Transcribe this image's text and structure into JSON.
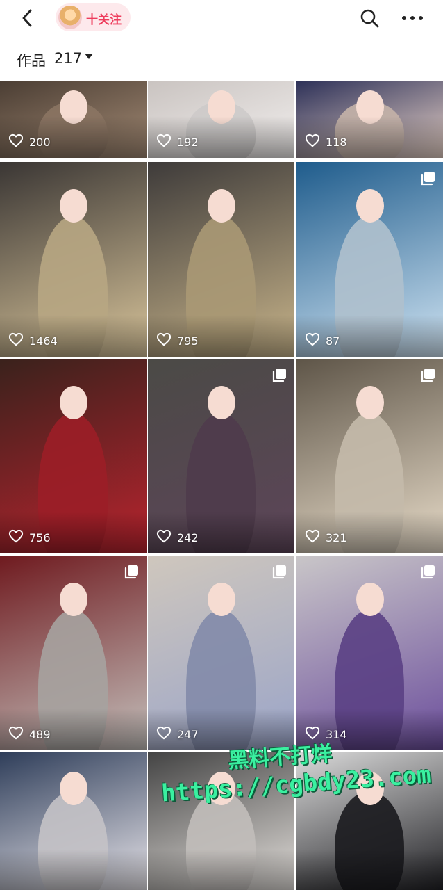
{
  "header": {
    "follow_label": "十关注",
    "icons": [
      "back-arrow-icon",
      "avatar",
      "search-icon",
      "more-icon"
    ]
  },
  "works": {
    "label": "作品",
    "count": "217"
  },
  "posts": [
    {
      "likes": "200",
      "multi": false,
      "bg": [
        "#4a3d33",
        "#a38a74"
      ]
    },
    {
      "likes": "192",
      "multi": false,
      "bg": [
        "#c9c3c0",
        "#f2efee"
      ]
    },
    {
      "likes": "118",
      "multi": false,
      "bg": [
        "#2b2f57",
        "#e8d2c7"
      ]
    },
    {
      "likes": "1464",
      "multi": false,
      "bg": [
        "#3a3634",
        "#d8c49a"
      ]
    },
    {
      "likes": "795",
      "multi": false,
      "bg": [
        "#3e3b3a",
        "#c8b48a"
      ]
    },
    {
      "likes": "87",
      "multi": true,
      "bg": [
        "#1f5c8c",
        "#cfe3f2"
      ]
    },
    {
      "likes": "756",
      "multi": false,
      "bg": [
        "#3a221c",
        "#b8232e"
      ]
    },
    {
      "likes": "242",
      "multi": true,
      "bg": [
        "#4b4a46",
        "#5d4559"
      ]
    },
    {
      "likes": "321",
      "multi": true,
      "bg": [
        "#5e5548",
        "#e8dcc9"
      ]
    },
    {
      "likes": "489",
      "multi": true,
      "bg": [
        "#6f1a1f",
        "#c4c0bc"
      ]
    },
    {
      "likes": "247",
      "multi": true,
      "bg": [
        "#cfc7bd",
        "#9aa4c8"
      ]
    },
    {
      "likes": "314",
      "multi": true,
      "bg": [
        "#c9c6c8",
        "#6b4d9c"
      ]
    },
    {
      "likes": "",
      "multi": false,
      "bg": [
        "#2f3e5a",
        "#e8e5ea"
      ]
    },
    {
      "likes": "",
      "multi": false,
      "bg": [
        "#444",
        "#e4e0dc"
      ]
    },
    {
      "likes": "",
      "multi": false,
      "bg": [
        "#dadada",
        "#1f1f23"
      ]
    }
  ],
  "watermark": {
    "line1": "黑料不打烊",
    "line2": "https://cgbdy23.com"
  },
  "colors": {
    "accent": "#ee3d5d",
    "pill_bg": "#fde9ec",
    "watermark": "#3af0a0"
  }
}
